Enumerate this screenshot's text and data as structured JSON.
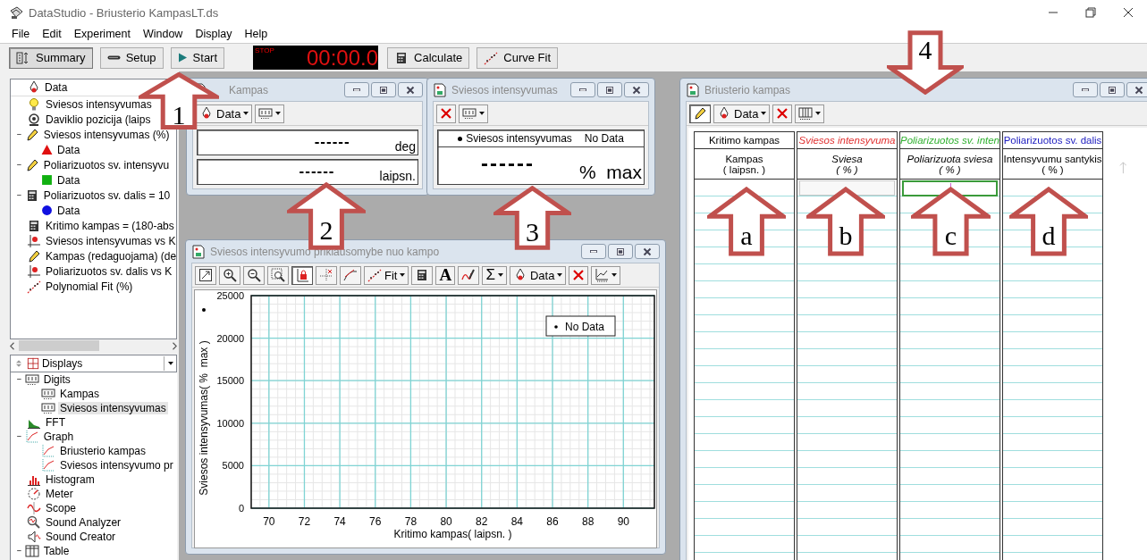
{
  "window": {
    "title": "DataStudio - Briusterio KampasLT.ds"
  },
  "menu": [
    "File",
    "Edit",
    "Experiment",
    "Window",
    "Display",
    "Help"
  ],
  "toolbar": {
    "buttons": [
      {
        "kind": "summary",
        "label": "Summary",
        "selected": true
      },
      {
        "kind": "setup",
        "label": "Setup",
        "selected": false
      },
      {
        "kind": "start",
        "label": "Start",
        "selected": false
      }
    ],
    "timer": {
      "state": "STOP",
      "time": "00:00.0"
    },
    "tools": [
      {
        "kind": "calculate",
        "label": "Calculate"
      },
      {
        "kind": "fit",
        "label": "Curve Fit"
      }
    ]
  },
  "data_panel": {
    "title": "Data",
    "items": [
      {
        "kind": "bulb",
        "label": "Sviesos intensyvumas",
        "expanded": false
      },
      {
        "kind": "sensor",
        "label": "Daviklio pozicija (laips",
        "expanded": false
      },
      {
        "kind": "pencil",
        "label": "Sviesos intensyvumas (%)",
        "expanded": true,
        "children": [
          {
            "kind": "triangle",
            "label": "Data",
            "color": "#e01010"
          }
        ]
      },
      {
        "kind": "pencil",
        "label": "Poliarizuotos sv. intensyvu",
        "expanded": true,
        "children": [
          {
            "kind": "square",
            "label": "Data",
            "color": "#10b010"
          }
        ]
      },
      {
        "kind": "calculator",
        "label": "Poliarizuotos sv. dalis = 10",
        "expanded": true,
        "children": [
          {
            "kind": "circle",
            "label": "Data",
            "color": "#1010e0"
          }
        ]
      },
      {
        "kind": "calculator",
        "label": "Kritimo kampas = (180-abs",
        "expanded": false
      },
      {
        "kind": "plot",
        "label": "Sviesos intensyvumas vs K",
        "expanded": false
      },
      {
        "kind": "pencil",
        "label": "Kampas (redaguojama) (de",
        "expanded": false
      },
      {
        "kind": "plot",
        "label": "Poliarizuotos sv. dalis vs K",
        "expanded": false
      },
      {
        "kind": "fit",
        "label": "Polynomial Fit (%)",
        "expanded": false
      }
    ]
  },
  "displays_panel": {
    "title": "Displays",
    "items": [
      {
        "kind": "digits",
        "label": "Digits",
        "expanded": true,
        "selected": false,
        "children": [
          {
            "kind": "digits",
            "label": "Kampas",
            "selected": false
          },
          {
            "kind": "digits",
            "label": "Sviesos intensyvumas",
            "selected": true
          }
        ]
      },
      {
        "kind": "fft",
        "label": "FFT",
        "expanded": false,
        "selected": false
      },
      {
        "kind": "graph",
        "label": "Graph",
        "expanded": true,
        "selected": false,
        "children": [
          {
            "kind": "graph",
            "label": "Briusterio kampas",
            "selected": false
          },
          {
            "kind": "graph",
            "label": "Sviesos intensyvumo pr",
            "selected": false
          }
        ]
      },
      {
        "kind": "histogram",
        "label": "Histogram",
        "expanded": false,
        "selected": false
      },
      {
        "kind": "meter",
        "label": "Meter",
        "expanded": false,
        "selected": false
      },
      {
        "kind": "scope",
        "label": "Scope",
        "expanded": false,
        "selected": false
      },
      {
        "kind": "analyzer",
        "label": "Sound Analyzer",
        "expanded": false,
        "selected": false
      },
      {
        "kind": "creator",
        "label": "Sound Creator",
        "expanded": false,
        "selected": false
      },
      {
        "kind": "table",
        "label": "Table",
        "expanded": true,
        "selected": false
      }
    ]
  },
  "windows": [
    {
      "kind": "digits",
      "title": "Kampas",
      "tools": [
        {
          "kind": "data",
          "label": "Data",
          "dropdown": true,
          "pressed": false
        },
        {
          "kind": "digits",
          "dropdown": true,
          "pressed": false
        }
      ],
      "readouts": [
        {
          "value": "------",
          "unit": "deg",
          "large": false
        },
        {
          "value": "------",
          "unit": "laipsn.",
          "large": false
        }
      ]
    },
    {
      "kind": "digits",
      "title": "Sviesos intensyvumas",
      "tools": [
        {
          "kind": "delete",
          "dropdown": false,
          "pressed": false
        },
        {
          "kind": "digits",
          "dropdown": true,
          "pressed": false
        }
      ],
      "legend": {
        "name": "Sviesos intensyvumas",
        "status": "No Data"
      },
      "readouts": [
        {
          "value": "------",
          "unit": "%  max",
          "large": true
        }
      ]
    },
    {
      "kind": "graph",
      "title": "Sviesos intensyvumo priklausomybe nuo kampo",
      "tools": [
        {
          "kind": "scale",
          "dropdown": false,
          "pressed": false
        },
        {
          "kind": "zoomin",
          "dropdown": false,
          "pressed": false
        },
        {
          "kind": "zoomout",
          "dropdown": false,
          "pressed": false
        },
        {
          "kind": "zoomsel",
          "dropdown": false,
          "pressed": false
        },
        {
          "kind": "lock",
          "dropdown": false,
          "pressed": true
        },
        {
          "kind": "smart",
          "dropdown": false,
          "pressed": false
        },
        {
          "kind": "slope",
          "dropdown": false,
          "pressed": false
        },
        {
          "kind": "fit",
          "label": "Fit",
          "dropdown": true,
          "pressed": false
        },
        {
          "kind": "calculator",
          "dropdown": false,
          "pressed": false
        },
        {
          "kind": "text",
          "label": "A",
          "dropdown": false,
          "pressed": false
        },
        {
          "kind": "note",
          "dropdown": false,
          "pressed": false
        },
        {
          "kind": "sum",
          "label": "Σ",
          "dropdown": true,
          "pressed": false
        },
        {
          "kind": "data",
          "label": "Data",
          "dropdown": true,
          "pressed": false
        },
        {
          "kind": "delete",
          "dropdown": false,
          "pressed": false
        },
        {
          "kind": "settings",
          "dropdown": true,
          "pressed": false
        }
      ],
      "legend_label": "No Data",
      "chart_data": {
        "type": "scatter",
        "grid": true,
        "xlabel": "Kritimo kampas( laipsn. )",
        "ylabel": "Sviesos intensyvumas( %  max )",
        "xlim": [
          69,
          91.75
        ],
        "ylim": [
          0,
          25000
        ],
        "xticks": [
          70,
          72,
          74,
          76,
          78,
          80,
          82,
          84,
          86,
          88,
          90
        ],
        "yticks": [
          0,
          5000,
          10000,
          15000,
          20000,
          25000
        ]
      }
    },
    {
      "kind": "table",
      "title": "Briusterio kampas",
      "tools": [
        {
          "kind": "pencil",
          "dropdown": false,
          "pressed": true
        },
        {
          "kind": "data",
          "label": "Data",
          "dropdown": true,
          "pressed": false
        },
        {
          "kind": "delete",
          "dropdown": false,
          "pressed": false
        },
        {
          "kind": "columns",
          "dropdown": true,
          "pressed": false
        }
      ],
      "columns": [
        {
          "dataset": "Kritimo kampas",
          "color": "#000000",
          "name": "Kampas",
          "unit": "( laipsn. )",
          "editable": false,
          "active": false
        },
        {
          "dataset": "Sviesos intensyvuma",
          "color": "#e03030",
          "name": "Sviesa",
          "unit": "( % )",
          "editable": true,
          "active": false
        },
        {
          "dataset": "Poliarizuotos sv. inten",
          "color": "#30b030",
          "name": "Poliarizuota sviesa",
          "unit": "( % )",
          "editable": true,
          "active": true
        },
        {
          "dataset": "Poliarizuotos sv. dalis",
          "color": "#2020c0",
          "name": "Intensyvumu santykis",
          "unit": "( % )",
          "editable": false,
          "active": false
        }
      ]
    }
  ],
  "callouts": [
    {
      "label": "1",
      "kind": "up"
    },
    {
      "label": "2",
      "kind": "up"
    },
    {
      "label": "3",
      "kind": "up"
    },
    {
      "label": "4",
      "kind": "down"
    },
    {
      "label": "a",
      "kind": "up"
    },
    {
      "label": "b",
      "kind": "up"
    },
    {
      "label": "c",
      "kind": "up"
    },
    {
      "label": "d",
      "kind": "up"
    }
  ]
}
